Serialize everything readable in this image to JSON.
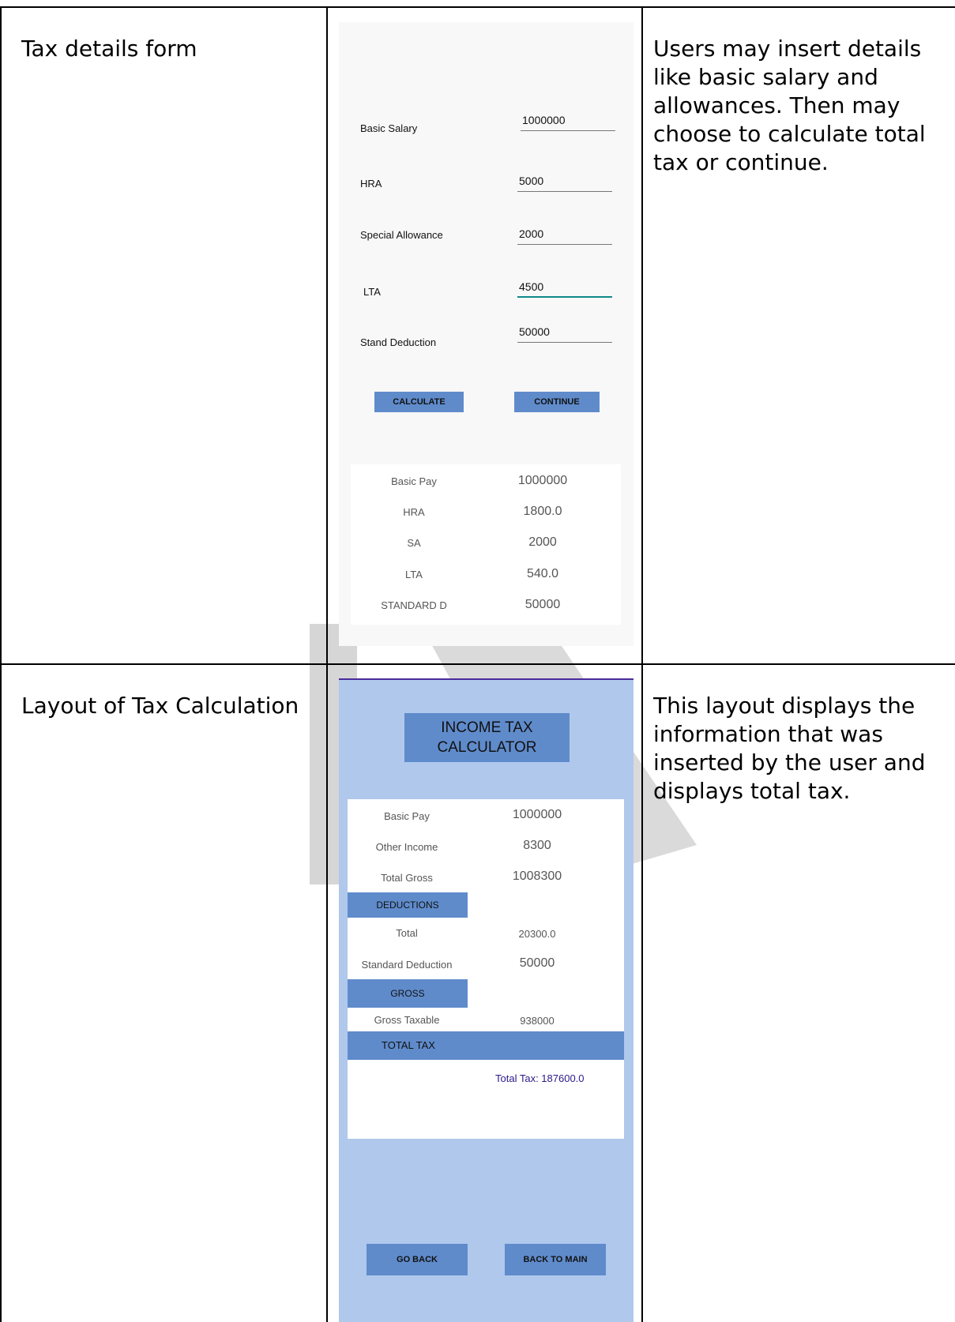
{
  "rows": [
    {
      "label": "Tax details form",
      "description": "Users may insert details like basic salary and allowances. Then may choose to calculate total tax or continue.",
      "screen": {
        "fields": [
          {
            "label": "Basic Salary",
            "value": "1000000"
          },
          {
            "label": "HRA",
            "value": "5000"
          },
          {
            "label": "Special Allowance",
            "value": "2000"
          },
          {
            "label": "LTA",
            "value": "4500"
          },
          {
            "label": "Stand Deduction",
            "value": "50000"
          }
        ],
        "buttons": {
          "calculate": "CALCULATE",
          "continue": "CONTINUE"
        },
        "results": [
          {
            "label": "Basic Pay",
            "value": "1000000"
          },
          {
            "label": "HRA",
            "value": "1800.0"
          },
          {
            "label": "SA",
            "value": "2000"
          },
          {
            "label": "LTA",
            "value": "540.0"
          },
          {
            "label": "STANDARD D",
            "value": "50000"
          }
        ]
      }
    },
    {
      "label": "Layout of Tax Calculation",
      "description": "This layout displays the information that was inserted by the user and displays total tax.",
      "screen": {
        "title": "INCOME TAX CALCULATOR",
        "income": [
          {
            "label": "Basic Pay",
            "value": "1000000"
          },
          {
            "label": "Other Income",
            "value": "8300"
          },
          {
            "label": "Total Gross",
            "value": "1008300"
          }
        ],
        "deductions_header": "DEDUCTIONS",
        "deductions": [
          {
            "label": "Total",
            "value": "20300.0"
          },
          {
            "label": "Standard Deduction",
            "value": "50000"
          }
        ],
        "gross_header": "GROSS",
        "gross": {
          "label": "Gross Taxable",
          "value": "938000"
        },
        "total_tax_header": "TOTAL TAX",
        "total_tax": "Total Tax: 187600.0",
        "buttons": {
          "go_back": "GO BACK",
          "back_to_main": "BACK TO MAIN"
        }
      }
    }
  ],
  "colors": {
    "button": "#5f8bcb",
    "screen2_bg": "#afc8ec",
    "total_tax_text": "#2a1a8a",
    "active_underline": "#0f8a8a"
  }
}
